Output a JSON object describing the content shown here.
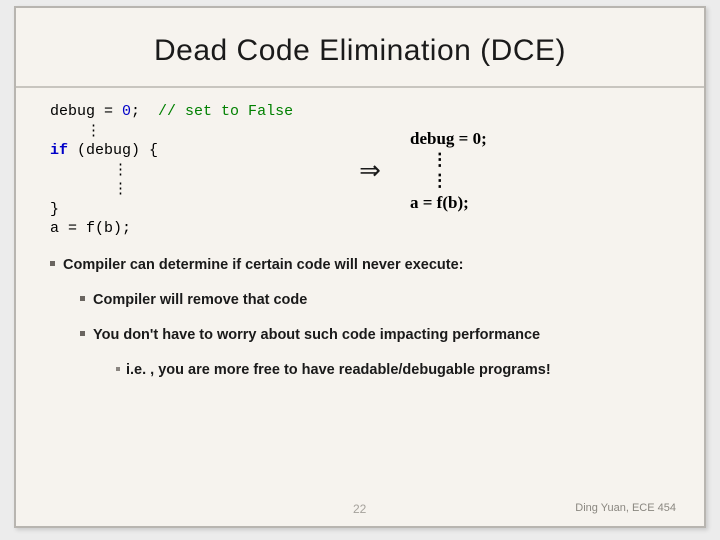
{
  "title": "Dead Code Elimination (DCE)",
  "code_left": {
    "l1a": "debug = ",
    "l1b": "0",
    "l1c": ";  ",
    "l1d": "// set to False",
    "l2": "    ⋮",
    "l3a": "if",
    "l3b": " (debug) {",
    "l4": "       ⋮",
    "l5": "       ⋮",
    "l6": "}",
    "l7": "a = f(b);"
  },
  "arrow": "⇒",
  "code_right": {
    "r1": "debug = 0;",
    "r2": "     ⋮",
    "r3": "     ⋮",
    "r4": "a = f(b);"
  },
  "bullets": {
    "b1": "Compiler can determine if certain code will never execute:",
    "b2a": "Compiler will remove that code",
    "b2b": "You don't have to worry about such code impacting performance",
    "b3": "i.e. , you are more free to have readable/debugable programs!"
  },
  "footer": {
    "page": "22",
    "attrib": "Ding Yuan, ECE 454"
  }
}
